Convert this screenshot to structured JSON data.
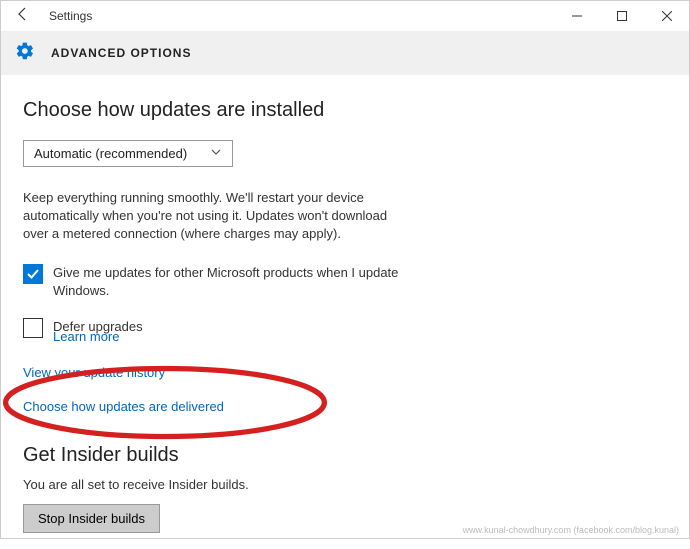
{
  "window": {
    "title": "Settings"
  },
  "page": {
    "header": "ADVANCED OPTIONS"
  },
  "main": {
    "heading": "Choose how updates are installed",
    "dropdown_value": "Automatic (recommended)",
    "description": "Keep everything running smoothly. We'll restart your device automatically when you're not using it. Updates won't download over a metered connection (where charges may apply).",
    "checkbox_other_products": {
      "checked": true,
      "label": "Give me updates for other Microsoft products when I update Windows."
    },
    "checkbox_defer": {
      "checked": false,
      "label": "Defer upgrades",
      "learn_more": "Learn more"
    },
    "link_history": "View your update history",
    "link_delivery": "Choose how updates are delivered"
  },
  "insider": {
    "heading": "Get Insider builds",
    "text": "You are all set to receive Insider builds.",
    "button": "Stop Insider builds"
  },
  "watermark": "www.kunal-chowdhury.com (facebook.com/blog.kunal)"
}
